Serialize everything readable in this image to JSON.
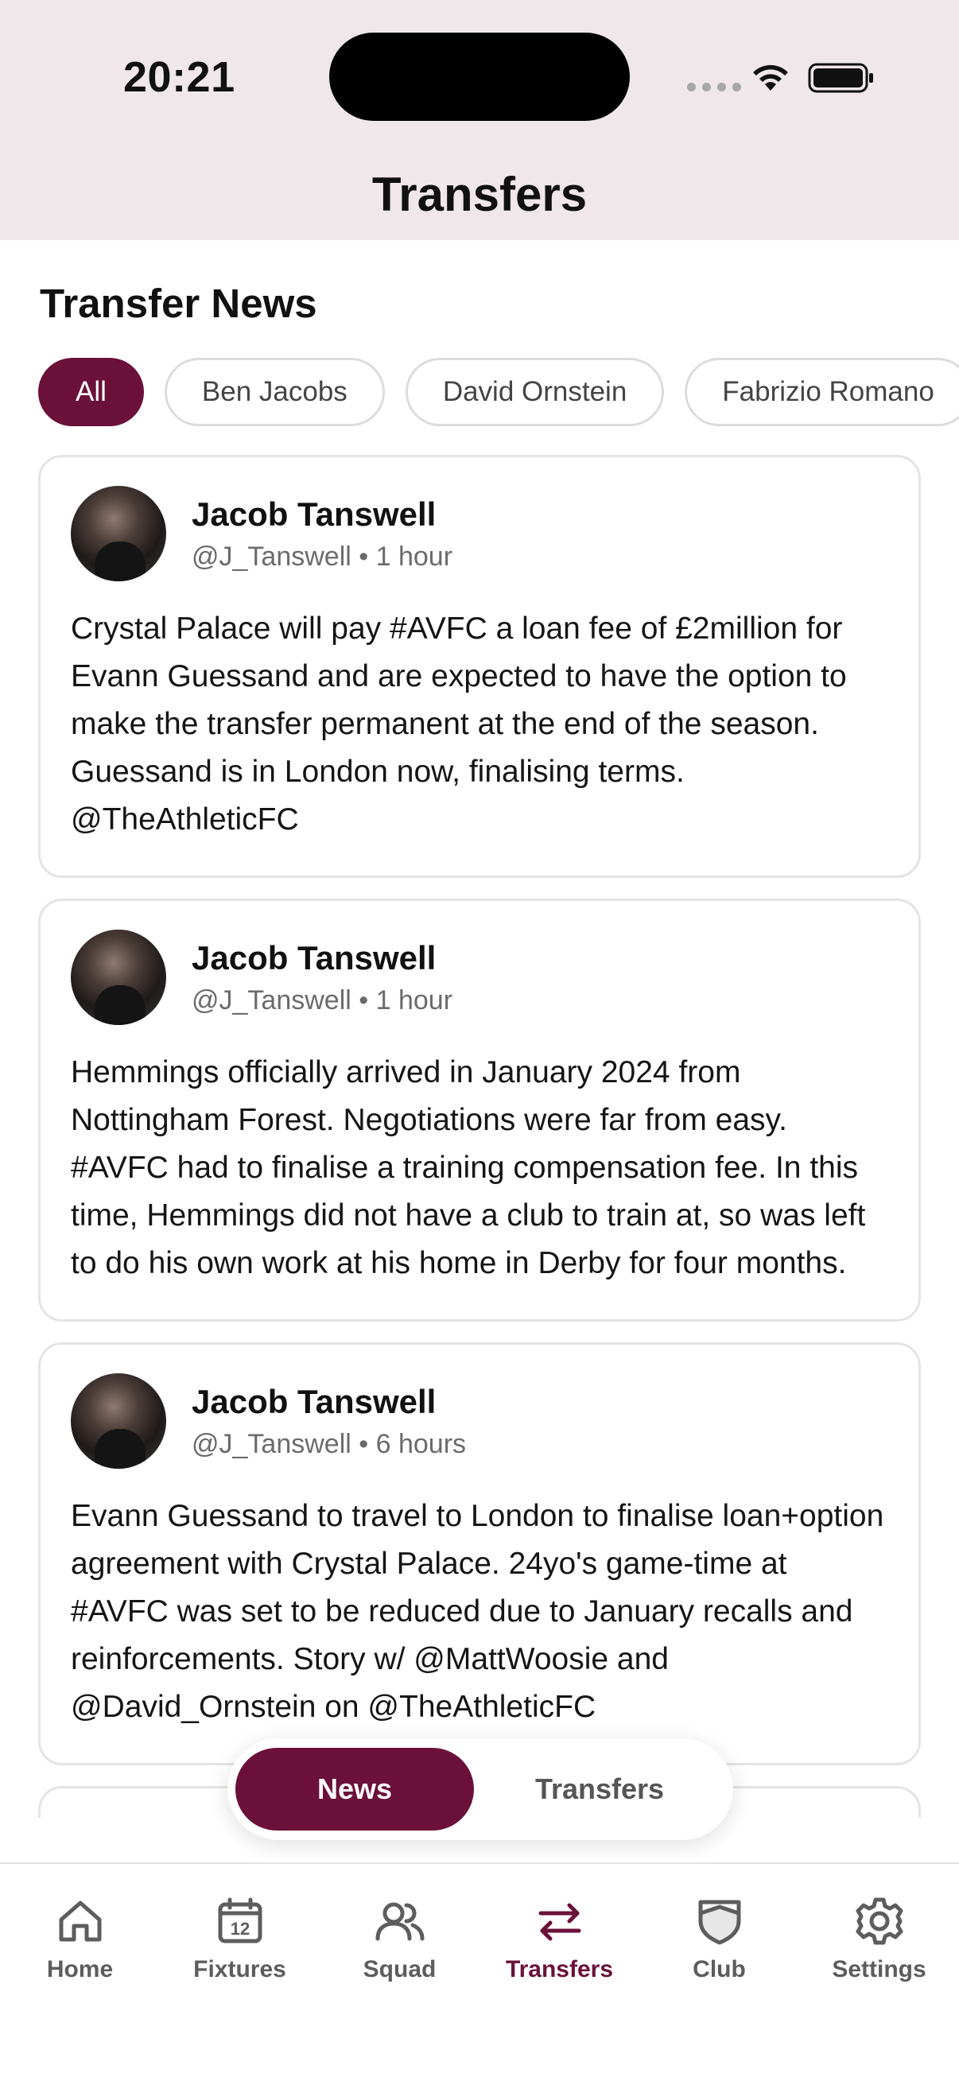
{
  "status_bar": {
    "time": "20:21"
  },
  "header": {
    "title": "Transfers"
  },
  "section": {
    "title": "Transfer News"
  },
  "filters": [
    "All",
    "Ben Jacobs",
    "David Ornstein",
    "Fabrizio Romano"
  ],
  "posts": [
    {
      "author": "Jacob Tanswell",
      "handle": "@J_Tanswell",
      "time": "1 hour",
      "text": "Crystal Palace will pay #AVFC a loan fee of £2million for Evann Guessand and are expected to have the option to make the transfer permanent at the end of the season. Guessand is in London now, finalising terms. @TheAthleticFC"
    },
    {
      "author": "Jacob Tanswell",
      "handle": "@J_Tanswell",
      "time": "1 hour",
      "text": "Hemmings officially arrived in January 2024 from Nottingham Forest. Negotiations were far from easy. #AVFC had to finalise a training compensation fee. In this time, Hemmings did not have a club to train at, so was left to do his own work at his home in Derby for four months."
    },
    {
      "author": "Jacob Tanswell",
      "handle": "@J_Tanswell",
      "time": "6 hours",
      "text": "Evann Guessand to travel to London to finalise loan+option agreement with Crystal Palace. 24yo's game-time at #AVFC was set to be reduced due to January recalls and reinforcements. Story w/ @MattWoosie and @David_Ornstein on @TheAthleticFC"
    }
  ],
  "segment": {
    "news": "News",
    "transfers": "Transfers",
    "selected": "News"
  },
  "tabs": [
    {
      "label": "Home",
      "icon": "home-icon"
    },
    {
      "label": "Fixtures",
      "icon": "calendar-icon",
      "day": "12"
    },
    {
      "label": "Squad",
      "icon": "people-icon"
    },
    {
      "label": "Transfers",
      "icon": "transfer-arrows-icon",
      "active": true
    },
    {
      "label": "Club",
      "icon": "shield-icon"
    },
    {
      "label": "Settings",
      "icon": "gear-icon"
    }
  ],
  "colors": {
    "accent": "#6b1139",
    "header_bg": "#efe7ea"
  }
}
